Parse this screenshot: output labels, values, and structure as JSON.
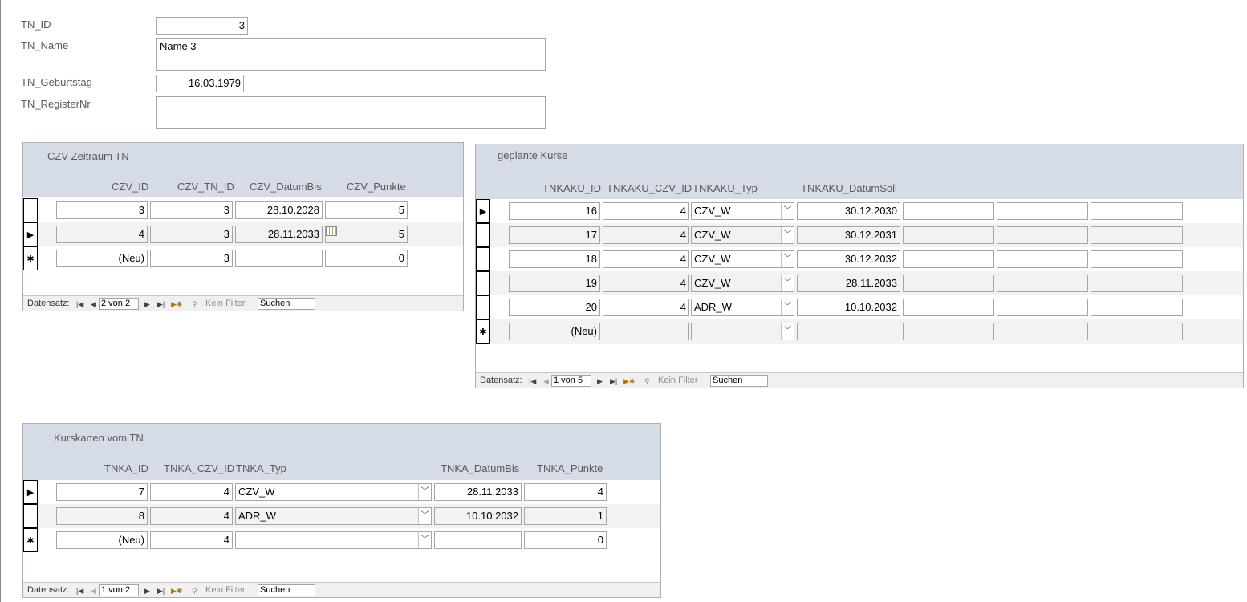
{
  "main": {
    "tn_id_label": "TN_ID",
    "tn_id_value": "3",
    "tn_name_label": "TN_Name",
    "tn_name_value": "Name 3",
    "tn_geb_label": "TN_Geburtstag",
    "tn_geb_value": "16.03.1979",
    "tn_reg_label": "TN_RegisterNr",
    "tn_reg_value": ""
  },
  "czv": {
    "title": "CZV Zeitraum TN",
    "columns": [
      "CZV_ID",
      "CZV_TN_ID",
      "CZV_DatumBis",
      "CZV_Punkte"
    ],
    "rows": [
      [
        "3",
        "3",
        "28.10.2028",
        "5"
      ],
      [
        "4",
        "3",
        "28.11.2033",
        "5"
      ],
      [
        "(Neu)",
        "3",
        "",
        "0"
      ]
    ],
    "nav": {
      "label": "Datensatz:",
      "position": "2 von 2",
      "filter": "Kein Filter",
      "search": "Suchen"
    }
  },
  "kurse": {
    "title": "geplante Kurse",
    "columns": [
      "TNKAKU_ID",
      "TNKAKU_CZV_ID",
      "TNKAKU_Typ",
      "TNKAKU_DatumSoll"
    ],
    "rows": [
      [
        "16",
        "4",
        "CZV_W",
        "30.12.2030"
      ],
      [
        "17",
        "4",
        "CZV_W",
        "30.12.2031"
      ],
      [
        "18",
        "4",
        "CZV_W",
        "30.12.2032"
      ],
      [
        "19",
        "4",
        "CZV_W",
        "28.11.2033"
      ],
      [
        "20",
        "4",
        "ADR_W",
        "10.10.2032"
      ],
      [
        "(Neu)",
        "",
        "",
        ""
      ]
    ],
    "nav": {
      "label": "Datensatz:",
      "position": "1 von 5",
      "filter": "Kein Filter",
      "search": "Suchen"
    }
  },
  "karten": {
    "title": "Kurskarten vom TN",
    "columns": [
      "TNKA_ID",
      "TNKA_CZV_ID",
      "TNKA_Typ",
      "TNKA_DatumBis",
      "TNKA_Punkte"
    ],
    "rows": [
      [
        "7",
        "4",
        "CZV_W",
        "28.11.2033",
        "4"
      ],
      [
        "8",
        "4",
        "ADR_W",
        "10.10.2032",
        "1"
      ],
      [
        "(Neu)",
        "4",
        "",
        "",
        "0"
      ]
    ],
    "nav": {
      "label": "Datensatz:",
      "position": "1 von 2",
      "filter": "Kein Filter",
      "search": "Suchen"
    }
  }
}
